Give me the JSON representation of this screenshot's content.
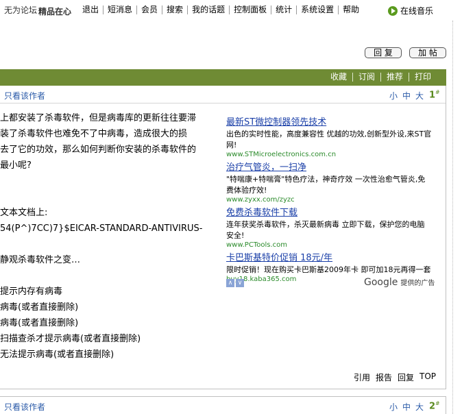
{
  "nav": {
    "brand": "无为论坛",
    "user": "精品在心",
    "links": [
      "退出",
      "短消息",
      "会员",
      "搜索",
      "我的话题",
      "控制面板",
      "统计",
      "系统设置",
      "帮助"
    ],
    "music": "在线音乐"
  },
  "buttons": {
    "reply": "回 复",
    "post": "加 帖"
  },
  "greenbar": [
    "收藏",
    "订阅",
    "推荐",
    "打印"
  ],
  "post1": {
    "author_only": "只看该作者",
    "font_sizes": [
      "小",
      "中",
      "大"
    ],
    "floor": "1",
    "content": [
      "上都安装了杀毒软件，但是病毒库的更新往往要滞",
      "装了杀毒软件也难免不了中病毒，造成很大的损",
      "去了它的功效，那么如何判断你安装的杀毒软件的",
      "最小呢?",
      "",
      "",
      "文本文档上:",
      "54(P^)7CC)7}$EICAR-STANDARD-ANTIVIRUS-",
      "",
      "静观杀毒软件之变…",
      "",
      "提示内存有病毒",
      "病毒(或者直接删除)",
      "病毒(或者直接删除)",
      "扫描查杀才提示病毒(或者直接删除)",
      "无法提示病毒(或者直接删除)"
    ],
    "footer": [
      "引用",
      "报告",
      "回复",
      "TOP"
    ]
  },
  "ads": [
    {
      "title": "最新ST微控制器领先技术",
      "desc": "出色的实时性能，高度兼容性 优越的功效,创新型外设,来ST官网!",
      "url": "www.STMicroelectronics.com.cn"
    },
    {
      "title": "治疗气管炎，一扫净",
      "desc": "\"特喘康+特喘膏\"特色疗法，神奇疗效 一次性治愈气管炎,免费体验疗效!",
      "url": "www.zyxx.com/zyzc"
    },
    {
      "title": "免费杀毒软件下载",
      "desc": "连年获奖杀毒软件，杀灭最新病毒 立即下载，保护您的电脑安全!",
      "url": "www.PCTools.com"
    },
    {
      "title": "卡巴斯基特价促销 18元/年",
      "desc": "限时促销！现在购买卡巴斯基2009年卡 即可加18元再得一套",
      "url": "buy18.kaba365.com"
    }
  ],
  "ad_nav": [
    "∧",
    "∨"
  ],
  "google": {
    "logo": "Google",
    "text": "提供的广告"
  },
  "post2": {
    "author_only": "只看该作者",
    "font_sizes": [
      "小",
      "中",
      "大"
    ],
    "floor": "2"
  }
}
